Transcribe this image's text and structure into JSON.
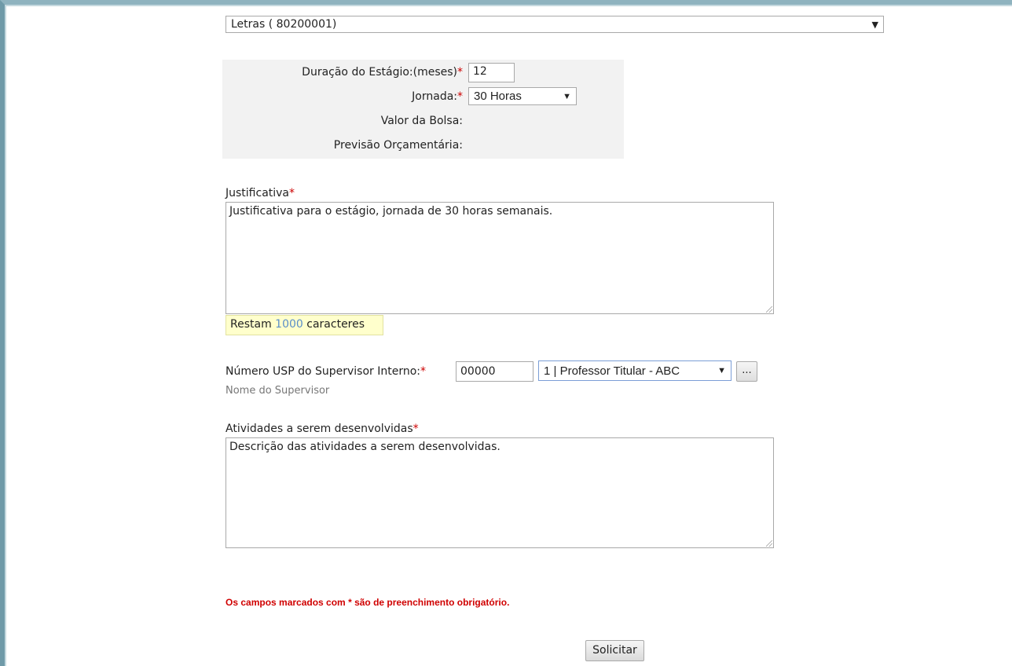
{
  "course": {
    "selected": "Letras ( 80200001)"
  },
  "internship": {
    "duration_label": "Duração do Estágio:(meses)",
    "duration_value": "12",
    "workload_label": "Jornada:",
    "workload_value": "30 Horas",
    "stipend_label": "Valor da Bolsa:",
    "budget_label": "Previsão Orçamentária:"
  },
  "justification": {
    "label": "Justificativa",
    "text": "Justificativa para o estágio, jornada de 30 horas semanais.",
    "counter_prefix": "Restam",
    "counter_value": "1000",
    "counter_suffix": "caracteres"
  },
  "supervisor": {
    "label": "Número USP do Supervisor Interno:",
    "usp_value": "00000",
    "selected": "1 | Professor Titular - ABC",
    "lookup_label": "...",
    "name_placeholder": "Nome do Supervisor"
  },
  "activities": {
    "label": "Atividades a serem desenvolvidas",
    "text": "Descrição das atividades a serem desenvolvidas."
  },
  "required_mark": "*",
  "dropdown_arrow": "▼",
  "footer": {
    "required_note": "Os campos marcados com * são de preenchimento obrigatório.",
    "submit_label": "Solicitar"
  }
}
